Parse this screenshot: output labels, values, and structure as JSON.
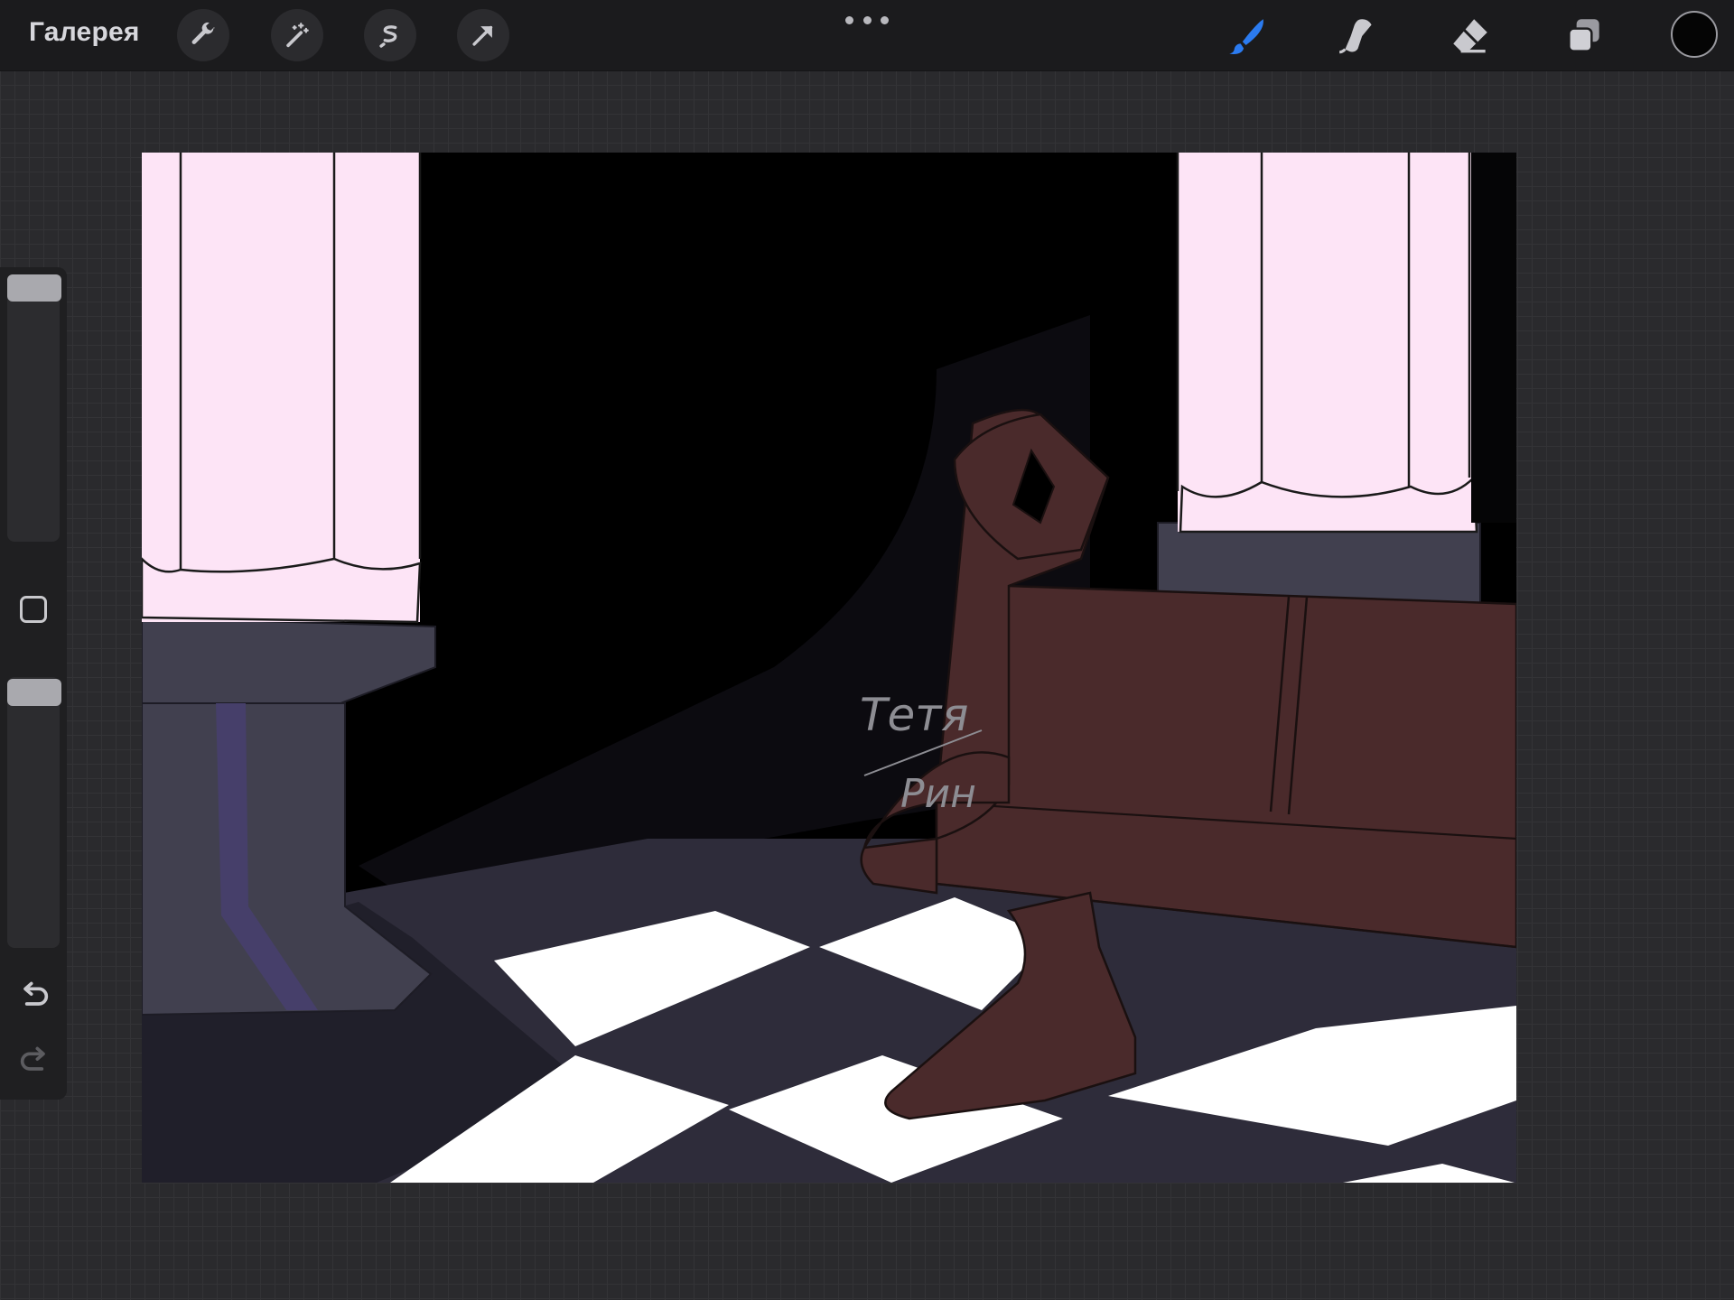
{
  "topbar": {
    "gallery_label": "Галерея",
    "left_tools": [
      "wrench-icon",
      "magic-wand-icon",
      "selection-icon",
      "transform-arrow-icon"
    ],
    "right_tools": [
      "brush-icon",
      "smudge-icon",
      "eraser-icon",
      "layers-icon"
    ],
    "active_tool": "brush-icon",
    "current_color": "#050505"
  },
  "sidebar": {
    "brush_size_slider": "brush-size-slider",
    "opacity_slider": "opacity-slider",
    "modify_button": "modify-button",
    "undo": "undo-icon",
    "redo": "redo-icon"
  },
  "canvas": {
    "signature_text": "Тетя Рин",
    "colors": {
      "background": "#000000",
      "column_fill": "#fde4f6",
      "pedestal": "#41404f",
      "purple_stripe": "#463f6a",
      "bench": "#4a2a2b",
      "floor_dark": "#2e2c3a",
      "floor_light": "#ffffff",
      "shadow": "#0c0b10"
    }
  }
}
